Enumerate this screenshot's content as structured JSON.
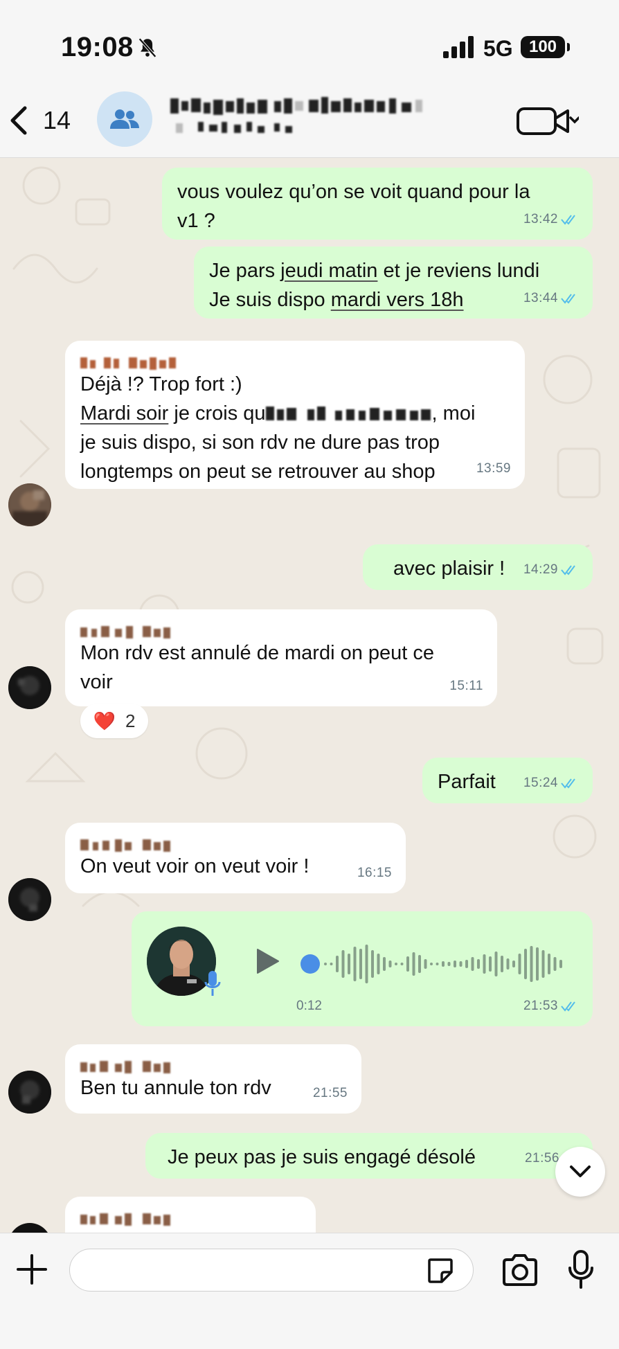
{
  "status_bar": {
    "time": "19:08",
    "network": "5G",
    "battery": "100"
  },
  "header": {
    "back_count": "14"
  },
  "messages": [
    {
      "dir": "out",
      "line1": "vous voulez qu’on se voit quand pour la",
      "line2": "v1 ?",
      "time": "13:42"
    },
    {
      "dir": "out",
      "pre1": "Je pars ",
      "u1": "jeudi matin",
      "post1": " et je reviens lundi",
      "pre2": "Je suis dispo ",
      "u2": "mardi vers 18h",
      "time": "13:44"
    },
    {
      "dir": "in",
      "line1": "Déjà !? Trop fort :)",
      "u2": "Mardi soir",
      "pre2": " je crois qu",
      "post2": ", moi",
      "line3": "je suis dispo, si son rdv ne dure pas trop",
      "line4": "longtemps on peut se retrouver au shop",
      "time": "13:59"
    },
    {
      "dir": "out",
      "text": "avec plaisir !",
      "time": "14:29"
    },
    {
      "dir": "in",
      "line1": "Mon rdv est annulé de mardi on peut ce",
      "line2": "voir",
      "time": "15:11",
      "reaction": {
        "emoji": "❤️",
        "count": "2"
      }
    },
    {
      "dir": "out",
      "text": "Parfait",
      "time": "15:24"
    },
    {
      "dir": "in",
      "text": "On veut voir on veut voir !",
      "time": "16:15"
    },
    {
      "dir": "out",
      "type": "voice",
      "duration": "0:12",
      "time": "21:53"
    },
    {
      "dir": "in",
      "text": "Ben tu annule ton rdv",
      "time": "21:55"
    },
    {
      "dir": "out",
      "text": "Je peux pas je suis engagé désolé",
      "time": "21:56"
    }
  ],
  "input": {
    "placeholder": ""
  },
  "colors": {
    "outgoing": "#d9fdd3",
    "incoming": "#ffffff",
    "tick": "#53bdeb",
    "background": "#efeae2"
  }
}
